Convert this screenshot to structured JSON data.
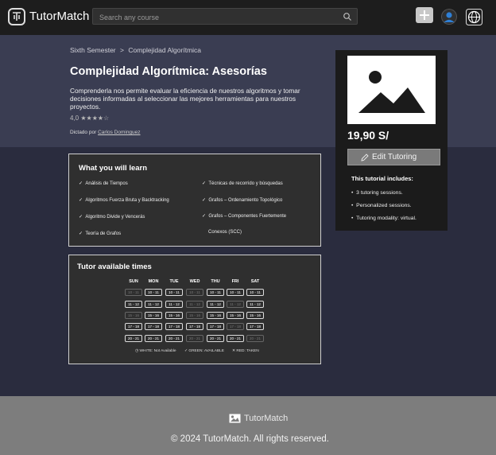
{
  "header": {
    "brand": "TutorMatch",
    "search_placeholder": "Search any course"
  },
  "breadcrumb": {
    "first": "Sixth Semester",
    "separator": ">",
    "second": "Complejidad Algorítmica"
  },
  "course": {
    "title": "Complejidad Algorítmica: Asesorías",
    "description": "Comprenderla nos permite evaluar la eficiencia de nuestros algoritmos y tomar decisiones informadas al seleccionar las mejores herramientas para nuestros proyectos.",
    "rating_value": "4,0",
    "rating_stars": "★★★★☆",
    "byline_prefix": "Dictado por",
    "tutor_name": "Carlos Dominguez"
  },
  "card": {
    "price": "19,90 S/",
    "edit_button": "Edit Tutoring",
    "includes_title": "This tutorial includes:",
    "includes": [
      "3 tutoring sessions.",
      "Personalized sessions.",
      "Tutoring modality: virtual."
    ]
  },
  "learn": {
    "title": "What you will learn",
    "left": [
      "Análisis de Tiempos",
      "Algoritmos Fuerza Bruta y Backtracking",
      "Algoritmo Divide y Vencerás",
      "Teoría de Grafos"
    ],
    "right": [
      "Técnicas de recorrido y búsquedas",
      "Grafos – Ordenamiento Topológico",
      "Grafos – Componentes Fuertemente",
      "Conexos (SCC)"
    ]
  },
  "times": {
    "title": "Tutor available times",
    "days": [
      "SUN",
      "MON",
      "TUE",
      "WED",
      "THU",
      "FRI",
      "SAT"
    ],
    "slots": [
      "10 - 11",
      "11 - 12",
      "15 - 16",
      "17 - 18",
      "20 - 21"
    ],
    "legend": [
      "WHITE: Not Available",
      "GREEN: AVAILABLE",
      "RED: TAKEN"
    ]
  },
  "footer": {
    "brand": "TutorMatch",
    "copyright": "© 2024 TutorMatch. All rights reserved."
  },
  "colors": {
    "topbar": "#1d1d1d",
    "hero": "#3a3d52",
    "content": "#2a2c3e",
    "footer": "#7d7d7d",
    "card": "#1b1b1b"
  }
}
